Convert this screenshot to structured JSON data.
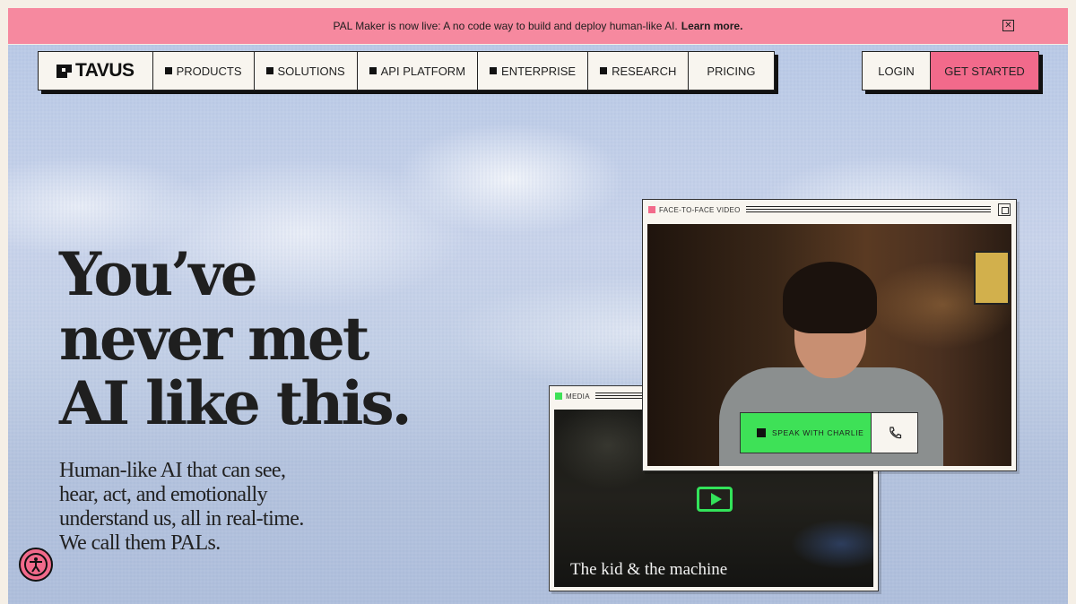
{
  "announcement": {
    "text": "PAL Maker is now live: A no code way to build and deploy human-like AI.",
    "link": "Learn more."
  },
  "nav": {
    "logo": "TAVUS",
    "items": [
      {
        "label": "PRODUCTS",
        "icon": "square-icon"
      },
      {
        "label": "SOLUTIONS",
        "icon": "square-icon"
      },
      {
        "label": "API PLATFORM",
        "icon": "square-icon"
      },
      {
        "label": "ENTERPRISE",
        "icon": "square-icon"
      },
      {
        "label": "RESEARCH",
        "icon": "square-icon"
      },
      {
        "label": "PRICING"
      }
    ],
    "login": "LOGIN",
    "get_started": "GET STARTED"
  },
  "hero": {
    "title_lines": [
      "You’ve",
      "never met",
      "AI like this."
    ],
    "subtitle": "Human-like AI that can see, hear, act, and emotionally understand us, all in real-time. We call them PALs."
  },
  "video_window": {
    "label": "FACE-TO-FACE VIDEO",
    "speak_button": "SPEAK WITH CHARLIE"
  },
  "media_window": {
    "label": "MEDIA",
    "caption": "The kid & the machine"
  },
  "colors": {
    "announcement_bg": "#f6899f",
    "accent_pink": "#f26a8b",
    "accent_green": "#3ee157",
    "frame_bg": "#f5efe6"
  }
}
